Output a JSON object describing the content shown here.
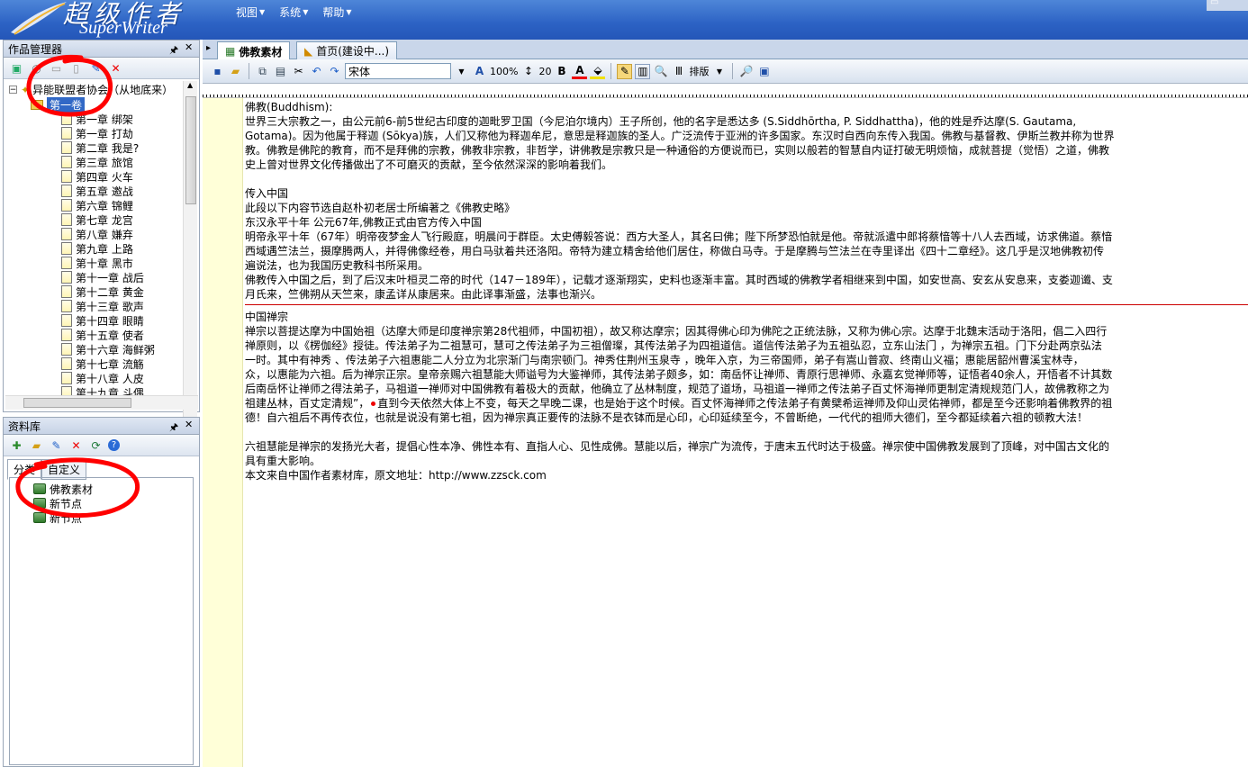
{
  "app": {
    "title_cn": "超级作者",
    "title_en": "SuperWriter"
  },
  "menu": [
    {
      "label": "视图"
    },
    {
      "label": "系统"
    },
    {
      "label": "帮助"
    }
  ],
  "works_panel": {
    "title": "作品管理器",
    "root": "异能联盟者协会（从地底来）",
    "volume": "第一卷",
    "chapters": [
      "第一章  绑架",
      "第一章  打劫",
      "第二章  我是?",
      "第三章  旅馆",
      "第四章  火车",
      "第五章  邀战",
      "第六章  锦鲤",
      "第七章  龙宫",
      "第八章  嫌弃",
      "第九章  上路",
      "第十章  黑市",
      "第十一章 战后",
      "第十二章 黄金",
      "第十三章 歌声",
      "第十四章  眼睛",
      "第十五章  使者",
      "第十六章 海鲜粥",
      "第十七章 流觞",
      "第十八章  人皮",
      "第十九章  斗偶"
    ]
  },
  "library_panel": {
    "title": "资料库",
    "tabs": [
      {
        "label": "分类"
      },
      {
        "label": "自定义"
      }
    ],
    "nodes": [
      "佛教素材",
      "新节点",
      "新节点"
    ]
  },
  "doc_tabs": [
    {
      "label": "佛教素材"
    },
    {
      "label": "首页(建设中...)"
    }
  ],
  "toolbar": {
    "font": "宋体",
    "zoom": "100%",
    "line_spacing": "20",
    "layout": "排版"
  },
  "editor": {
    "lines": [
      "佛教(Buddhism):",
      "世界三大宗教之一，由公元前6-前5世纪古印度的迦毗罗卫国（今尼泊尔境内）王子所创，他的名字是悉达多  (S.Siddhōrtha,  P.  Siddhattha)，他的姓是乔达摩(S.  Gautama,",
      "Gotama)。因为他属于释迦 (Sōkya)族，人们又称他为释迦牟尼，意思是释迦族的圣人。广泛流传于亚洲的许多国家。东汉时自西向东传入我国。佛教与基督教、伊斯兰教并称为世界",
      "教。佛教是佛陀的教育，而不是拜佛的宗教，佛教非宗教，非哲学，讲佛教是宗教只是一种通俗的方便说而已，实则以般若的智慧自内证打破无明烦恼，成就菩提（觉悟）之道，佛教",
      "史上曾对世界文化传播做出了不可磨灭的贡献，至今依然深深的影响着我们。",
      "",
      "传入中国",
      "此段以下内容节选自赵朴初老居士所编著之《佛教史略》",
      "东汉永平十年 公元67年,佛教正式由官方传入中国",
      "明帝永平十年（67年）明帝夜梦金人飞行殿庭，明晨问于群臣。太史傅毅答说：西方大圣人，其名曰佛；陛下所梦恐怕就是他。帝就派遣中郎将蔡愔等十八人去西域，访求佛道。蔡愔",
      "西域遇竺法兰，摄摩腾两人，并得佛像经卷，用白马驮着共还洛阳。帝特为建立精舍给他们居住，称做白马寺。于是摩腾与竺法兰在寺里译出《四十二章经》。这几乎是汉地佛教初传",
      "遍说法，也为我国历史教科书所采用。",
      "佛教传入中国之后，到了后汉末叶桓灵二帝的时代（147－189年），记载才逐渐翔实，史料也逐渐丰富。其时西域的佛教学者相继来到中国，如安世高、安玄从安息来，支娄迦谶、支",
      "月氏来，竺佛朔从天竺来，康孟详从康居来。由此译事渐盛，法事也渐兴。"
    ],
    "lines2": [
      "中国禅宗",
      "禅宗以菩提达摩为中国始祖（达摩大师是印度禅宗第28代祖师，中国初祖），故又称达摩宗；因其得佛心印为佛陀之正统法脉，又称为佛心宗。达摩于北魏末活动于洛阳，倡二入四行",
      "禅原则，以《楞伽经》授徒。传法弟子为二祖慧可，慧可之传法弟子为三祖僧璨，其传法弟子为四祖道信。道信传法弟子为五祖弘忍，立东山法门  ，为禅宗五祖。门下分赴两京弘法",
      "一时。其中有神秀   、传法弟子六祖惠能二人分立为北宗渐门与南宗顿门。神秀住荆州玉泉寺   ，晚年入京，为三帝国师，弟子有嵩山普寂、终南山义福；惠能居韶州曹溪宝林寺，",
      "众，以惠能为六祖。后为禅宗正宗。皇帝亲赐六祖慧能大师谥号为大鉴禅师，其传法弟子颇多，如：南岳怀让禅师、青原行思禅师、永嘉玄觉禅师等，证悟者40余人，开悟者不计其数",
      "后南岳怀让禅师之得法弟子，马祖道一禅师对中国佛教有着极大的贡献，他确立了丛林制度，规范了道场，马祖道一禅师之传法弟子百丈怀海禅师更制定清规规范门人，故佛教称之为",
      "祖建丛林，百丈定清规”，",
      "德！自六祖后不再传衣位，也就是说没有第七祖，因为禅宗真正要传的法脉不是衣钵而是心印，心印延续至今，不曾断绝，一代代的祖师大德们，至今都延续着六祖的顿教大法！",
      "",
      "六祖慧能是禅宗的发扬光大者，提倡心性本净、佛性本有、直指人心、见性成佛。慧能以后，禅宗广为流传，于唐末五代时达于极盛。禅宗使中国佛教发展到了顶峰，对中国古文化的",
      "具有重大影响。",
      "本文来自中国作者素材库，原文地址：http://www.zzsck.com"
    ],
    "line_after_dot": "直到今天依然大体上不变，每天之早晚二课，也是始于这个时候。百丈怀海禅师之传法弟子有黄檗希运禅师及仰山灵佑禅师，都是至今还影响着佛教界的祖"
  },
  "colors": {
    "title_bg": "#2c62c4",
    "selection": "#3168c6",
    "annotation": "#ff0000",
    "gutter": "#ffffd8"
  }
}
